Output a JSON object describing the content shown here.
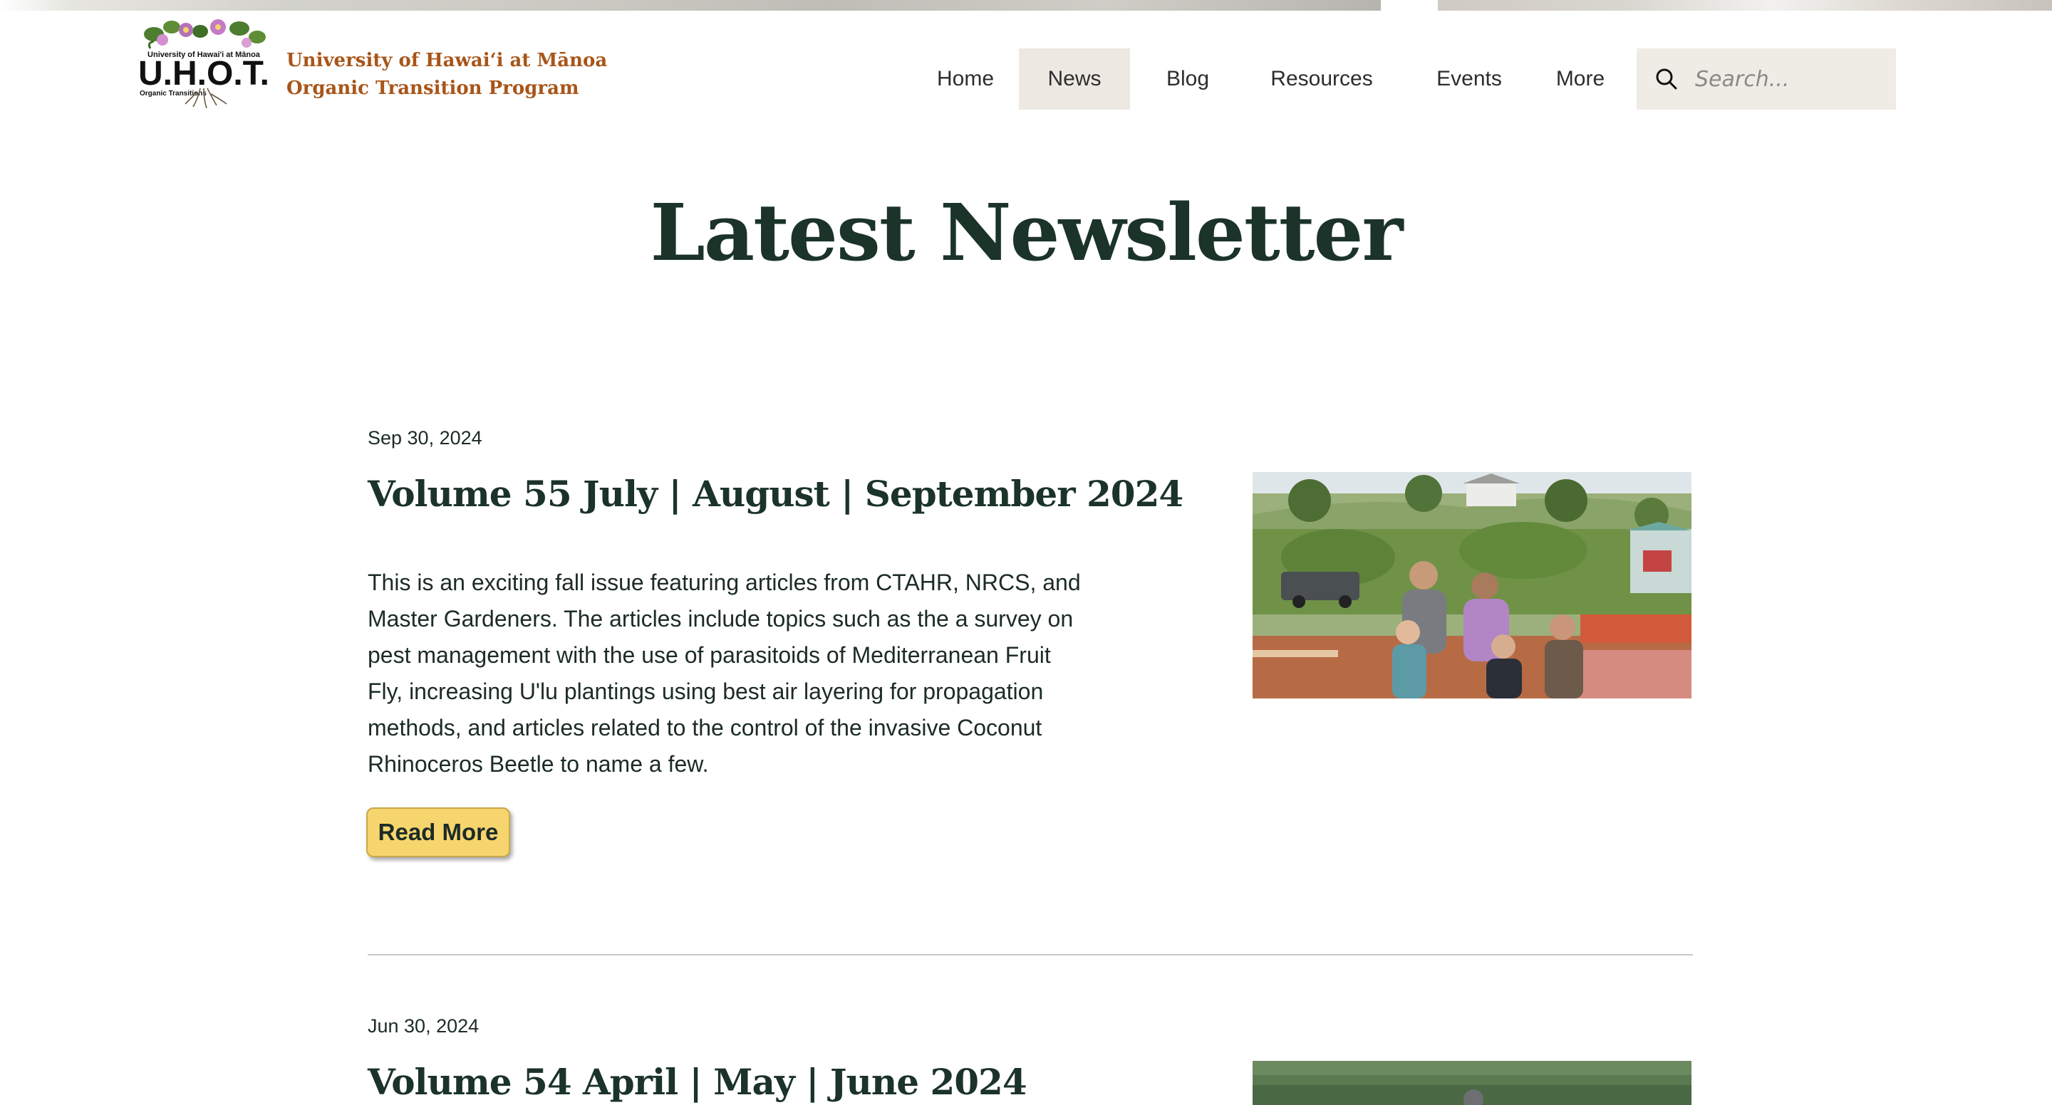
{
  "header": {
    "logo_text": "U.H.O.T.",
    "logo_arc_text": "University of Hawai'i at Mānoa",
    "logo_sub_text": "Organic Transitions",
    "brand_line1": "University of Hawaiʻi at Mānoa",
    "brand_line2": "Organic Transition Program"
  },
  "nav": {
    "items": [
      {
        "label": "Home"
      },
      {
        "label": "News",
        "active": true
      },
      {
        "label": "Blog"
      },
      {
        "label": "Resources"
      },
      {
        "label": "Events"
      },
      {
        "label": "More"
      }
    ]
  },
  "search": {
    "placeholder": "Search...",
    "icon": "search-icon"
  },
  "main": {
    "title": "Latest Newsletter"
  },
  "posts": [
    {
      "date": "Sep 30, 2024",
      "title": "Volume 55 July | August | September 2024",
      "body": [
        "This is an exciting fall issue featuring articles from CTAHR, NRCS, and",
        "Master Gardeners. The articles include topics such as the a survey on",
        "pest management with the use of parasitoids of Mediterranean Fruit",
        "Fly, increasing U'lu plantings using best air layering for propagation",
        "methods, and articles related to the control of the invasive Coconut",
        "Rhinoceros Beetle to name a few."
      ],
      "button_label": "Read More"
    },
    {
      "date": "Jun 30, 2024",
      "title": "Volume 54 April | May | June 2024"
    }
  ],
  "colors": {
    "brand": "#a85518",
    "heading": "#1b3329",
    "nav_active_bg": "#ede8e1",
    "search_bg": "#efebe5",
    "button_bg": "#f6d56e"
  }
}
